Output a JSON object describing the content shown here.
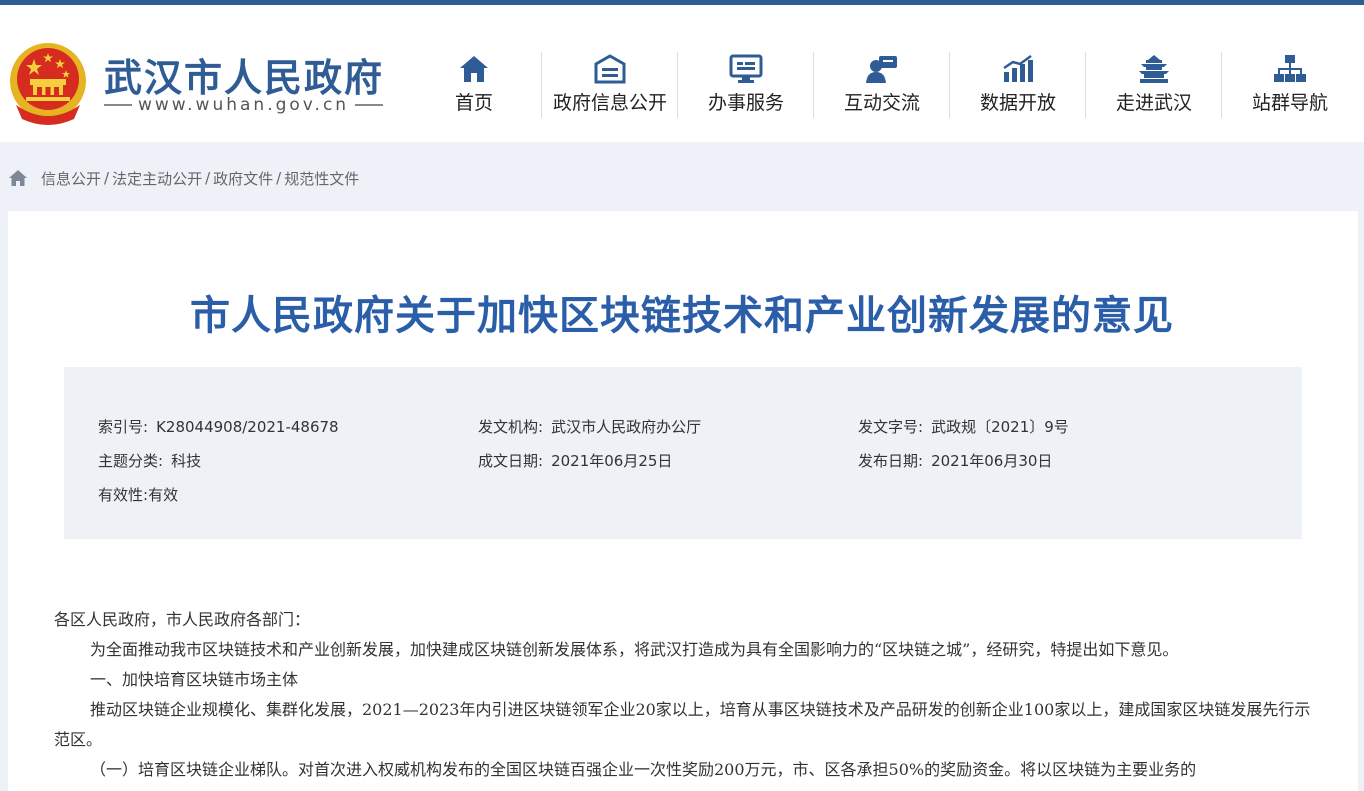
{
  "header": {
    "site_name": "武汉市人民政府",
    "site_url": "www.wuhan.gov.cn",
    "emblem_icon": "national-emblem-icon",
    "brand_color": "#2f5c94"
  },
  "nav": [
    {
      "label": "首页",
      "icon": "home-icon"
    },
    {
      "label": "政府信息公开",
      "icon": "info-disclosure-icon"
    },
    {
      "label": "办事服务",
      "icon": "service-monitor-icon"
    },
    {
      "label": "互动交流",
      "icon": "chat-user-icon"
    },
    {
      "label": "数据开放",
      "icon": "bar-chart-icon"
    },
    {
      "label": "走进武汉",
      "icon": "pavilion-icon"
    },
    {
      "label": "站群导航",
      "icon": "sitemap-icon"
    }
  ],
  "breadcrumb": {
    "home_icon": "home-icon",
    "items": [
      "信息公开",
      "法定主动公开",
      "政府文件",
      "规范性文件"
    ]
  },
  "article": {
    "title": "市人民政府关于加快区块链技术和产业创新发展的意见",
    "meta": {
      "index_label": "索引号:",
      "index_value": "K28044908/2021-48678",
      "issuer_label": "发文机构:",
      "issuer_value": "武汉市人民政府办公厅",
      "doc_no_label": "发文字号:",
      "doc_no_value": "武政规〔2021〕9号",
      "topic_label": "主题分类:",
      "topic_value": "科技",
      "created_label": "成文日期:",
      "created_value": "2021年06月25日",
      "published_label": "发布日期:",
      "published_value": "2021年06月30日",
      "validity_label": "有效性:",
      "validity_value": "有效"
    },
    "paragraphs": [
      "各区人民政府，市人民政府各部门：",
      "为全面推动我市区块链技术和产业创新发展，加快建成区块链创新发展体系，将武汉打造成为具有全国影响力的“区块链之城”，经研究，特提出如下意见。",
      "一、加快培育区块链市场主体",
      "推动区块链企业规模化、集群化发展，2021—2023年内引进区块链领军企业20家以上，培育从事区块链技术及产品研发的创新企业100家以上，建成国家区块链发展先行示范区。",
      "（一）培育区块链企业梯队。对首次进入权威机构发布的全国区块链百强企业一次性奖励200万元，市、区各承担50%的奖励资金。将以区块链为主要业务的"
    ]
  }
}
